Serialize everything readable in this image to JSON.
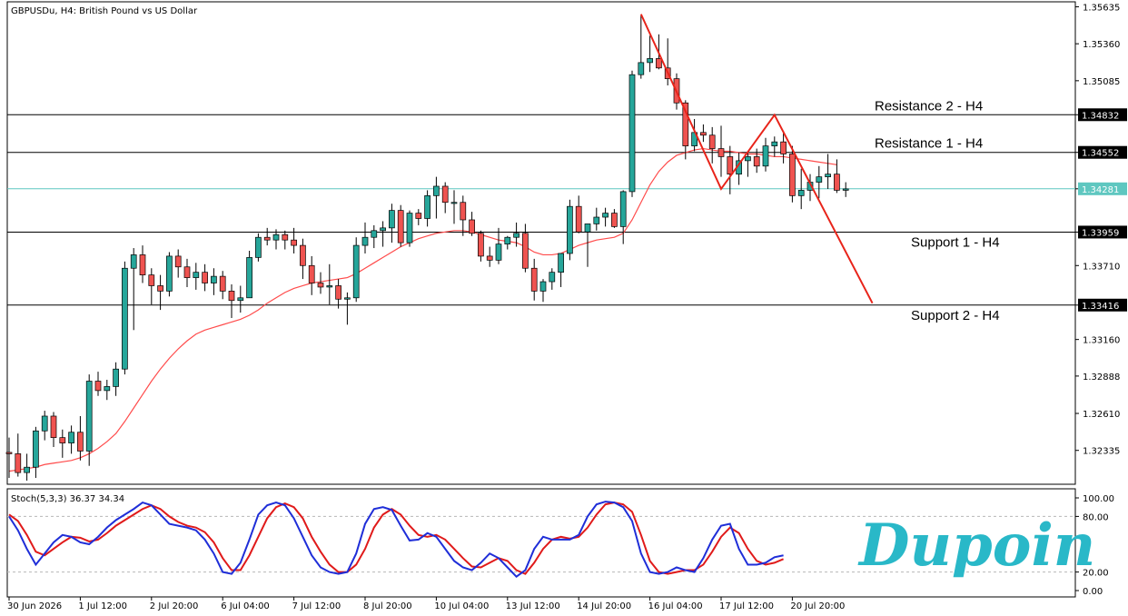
{
  "window": {
    "title": "GBPUSDu, H4:  British Pound vs US Dollar",
    "logo_text": "Dupoin"
  },
  "colors": {
    "bull": "#26a69a",
    "bear": "#ef5350",
    "candle_outline": "#000000",
    "ma": "#ff4b4b",
    "current_price": "#5fc7c0",
    "trendline": "#e8241a",
    "stoch_main": "#1f2ed8",
    "stoch_signal": "#e01a1a",
    "logo": "#29b8c8"
  },
  "chart_data": {
    "type": "candlestick",
    "symbol": "GBPUSDu",
    "timeframe": "H4",
    "ylim": [
      1.32083,
      1.35672
    ],
    "price_ticks": [
      "1.35635",
      "1.35360",
      "1.35085",
      "1.34832",
      "1.34552",
      "1.34281",
      "1.33959",
      "1.33710",
      "1.33416",
      "1.33160",
      "1.32888",
      "1.32610",
      "1.32335"
    ],
    "price_tick_values": [
      1.35635,
      1.3536,
      1.35085,
      1.34832,
      1.34552,
      1.34281,
      1.33959,
      1.3371,
      1.33416,
      1.3316,
      1.32888,
      1.3261,
      1.32335
    ],
    "time_labels": [
      "30 Jun 2026",
      "1 Jul 12:00",
      "2 Jul 20:00",
      "6 Jul 04:00",
      "7 Jul 12:00",
      "8 Jul 20:00",
      "10 Jul 04:00",
      "13 Jul 12:00",
      "14 Jul 20:00",
      "16 Jul 04:00",
      "17 Jul 12:00",
      "20 Jul 20:00"
    ],
    "time_label_bar_index": [
      0,
      8,
      16,
      24,
      32,
      40,
      48,
      56,
      64,
      72,
      80,
      88
    ],
    "current_price": "1.34281",
    "levels": [
      {
        "label": "Resistance 2 - H4",
        "price": "1.34832"
      },
      {
        "label": "Resistance 1 - H4",
        "price": "1.34552"
      },
      {
        "label": "Support 1 - H4",
        "price": "1.33959"
      },
      {
        "label": "Support 2 - H4",
        "price": "1.33416"
      }
    ],
    "ohlc": [
      [
        1.3232,
        1.3243,
        1.3213,
        1.3231
      ],
      [
        1.3231,
        1.3246,
        1.3214,
        1.3217
      ],
      [
        1.3217,
        1.3231,
        1.3211,
        1.3221
      ],
      [
        1.3221,
        1.3251,
        1.3213,
        1.3248
      ],
      [
        1.3248,
        1.3263,
        1.3241,
        1.3259
      ],
      [
        1.3259,
        1.3262,
        1.3236,
        1.3243
      ],
      [
        1.3243,
        1.3249,
        1.3228,
        1.3239
      ],
      [
        1.3239,
        1.3252,
        1.3231,
        1.3247
      ],
      [
        1.3247,
        1.3259,
        1.3226,
        1.3233
      ],
      [
        1.3233,
        1.329,
        1.3222,
        1.3285
      ],
      [
        1.3285,
        1.3292,
        1.3274,
        1.3278
      ],
      [
        1.3278,
        1.3286,
        1.3271,
        1.3281
      ],
      [
        1.3281,
        1.3299,
        1.3274,
        1.3294
      ],
      [
        1.3294,
        1.3374,
        1.329,
        1.3369
      ],
      [
        1.3369,
        1.3384,
        1.3323,
        1.3379
      ],
      [
        1.3379,
        1.3386,
        1.3358,
        1.3364
      ],
      [
        1.3364,
        1.3369,
        1.3342,
        1.3356
      ],
      [
        1.3356,
        1.3364,
        1.3338,
        1.3352
      ],
      [
        1.3352,
        1.3381,
        1.3348,
        1.3378
      ],
      [
        1.3378,
        1.3383,
        1.3362,
        1.337
      ],
      [
        1.337,
        1.3376,
        1.3355,
        1.3362
      ],
      [
        1.3362,
        1.3373,
        1.3353,
        1.3366
      ],
      [
        1.3366,
        1.3372,
        1.3352,
        1.3358
      ],
      [
        1.3358,
        1.3369,
        1.3349,
        1.3363
      ],
      [
        1.3363,
        1.3367,
        1.3346,
        1.3352
      ],
      [
        1.3352,
        1.3357,
        1.3332,
        1.3345
      ],
      [
        1.3345,
        1.3356,
        1.3336,
        1.3347
      ],
      [
        1.3347,
        1.3382,
        1.3347,
        1.3377
      ],
      [
        1.3377,
        1.3395,
        1.3374,
        1.3392
      ],
      [
        1.3392,
        1.3399,
        1.3386,
        1.339
      ],
      [
        1.339,
        1.3398,
        1.3383,
        1.3394
      ],
      [
        1.3394,
        1.3397,
        1.3383,
        1.339
      ],
      [
        1.339,
        1.3399,
        1.338,
        1.3386
      ],
      [
        1.3386,
        1.3391,
        1.3361,
        1.3371
      ],
      [
        1.3371,
        1.3378,
        1.3349,
        1.3358
      ],
      [
        1.3358,
        1.3366,
        1.335,
        1.3355
      ],
      [
        1.3355,
        1.3372,
        1.3342,
        1.3356
      ],
      [
        1.3356,
        1.3361,
        1.3339,
        1.3346
      ],
      [
        1.3346,
        1.3351,
        1.3327,
        1.3347
      ],
      [
        1.3347,
        1.3392,
        1.3344,
        1.3386
      ],
      [
        1.3386,
        1.3403,
        1.338,
        1.3392
      ],
      [
        1.3392,
        1.3401,
        1.3384,
        1.3397
      ],
      [
        1.3397,
        1.3404,
        1.3385,
        1.3399
      ],
      [
        1.3399,
        1.3417,
        1.3388,
        1.3412
      ],
      [
        1.3412,
        1.3416,
        1.3385,
        1.3388
      ],
      [
        1.3388,
        1.3412,
        1.3385,
        1.341
      ],
      [
        1.341,
        1.3413,
        1.3401,
        1.3406
      ],
      [
        1.3406,
        1.3427,
        1.34,
        1.3423
      ],
      [
        1.3423,
        1.3437,
        1.3406,
        1.343
      ],
      [
        1.343,
        1.3433,
        1.341,
        1.3418
      ],
      [
        1.3418,
        1.3427,
        1.3402,
        1.3418
      ],
      [
        1.3418,
        1.3423,
        1.3393,
        1.3405
      ],
      [
        1.3405,
        1.3411,
        1.3393,
        1.3395
      ],
      [
        1.3395,
        1.3397,
        1.3374,
        1.3378
      ],
      [
        1.3378,
        1.3385,
        1.337,
        1.3375
      ],
      [
        1.3375,
        1.3399,
        1.3372,
        1.3387
      ],
      [
        1.3387,
        1.3393,
        1.3383,
        1.3392
      ],
      [
        1.3392,
        1.3403,
        1.3385,
        1.3395
      ],
      [
        1.3395,
        1.3402,
        1.3366,
        1.3369
      ],
      [
        1.3369,
        1.3376,
        1.3345,
        1.3352
      ],
      [
        1.3352,
        1.3361,
        1.3344,
        1.3359
      ],
      [
        1.3359,
        1.3369,
        1.3353,
        1.3366
      ],
      [
        1.3366,
        1.3371,
        1.3355,
        1.338
      ],
      [
        1.338,
        1.342,
        1.3375,
        1.3415
      ],
      [
        1.3415,
        1.3423,
        1.3395,
        1.3396
      ],
      [
        1.3396,
        1.3402,
        1.337,
        1.3402
      ],
      [
        1.3402,
        1.3414,
        1.3397,
        1.3407
      ],
      [
        1.3407,
        1.3414,
        1.34,
        1.341
      ],
      [
        1.341,
        1.3413,
        1.3399,
        1.34
      ],
      [
        1.34,
        1.3427,
        1.3387,
        1.3426
      ],
      [
        1.3426,
        1.3516,
        1.3422,
        1.3513
      ],
      [
        1.3513,
        1.3557,
        1.351,
        1.3522
      ],
      [
        1.3522,
        1.3542,
        1.3515,
        1.3525
      ],
      [
        1.3525,
        1.3543,
        1.3517,
        1.3518
      ],
      [
        1.3518,
        1.354,
        1.3505,
        1.351
      ],
      [
        1.351,
        1.3514,
        1.3487,
        1.3492
      ],
      [
        1.3492,
        1.3494,
        1.345,
        1.346
      ],
      [
        1.346,
        1.348,
        1.3456,
        1.347
      ],
      [
        1.347,
        1.3476,
        1.3463,
        1.3468
      ],
      [
        1.3468,
        1.3474,
        1.3447,
        1.3458
      ],
      [
        1.3458,
        1.3475,
        1.3437,
        1.3452
      ],
      [
        1.3452,
        1.346,
        1.3424,
        1.3439
      ],
      [
        1.3439,
        1.3455,
        1.3431,
        1.3449
      ],
      [
        1.3449,
        1.3456,
        1.3437,
        1.3452
      ],
      [
        1.3452,
        1.3458,
        1.344,
        1.3445
      ],
      [
        1.3445,
        1.3466,
        1.3441,
        1.346
      ],
      [
        1.346,
        1.3467,
        1.3452,
        1.3463
      ],
      [
        1.3463,
        1.3471,
        1.3447,
        1.3454
      ],
      [
        1.3454,
        1.346,
        1.3418,
        1.3423
      ],
      [
        1.3423,
        1.3443,
        1.3413,
        1.3427
      ],
      [
        1.3427,
        1.3439,
        1.3419,
        1.3433
      ],
      [
        1.3433,
        1.3445,
        1.3421,
        1.3437
      ],
      [
        1.3437,
        1.3454,
        1.3428,
        1.3439
      ],
      [
        1.3439,
        1.345,
        1.3425,
        1.3427
      ],
      [
        1.3427,
        1.3433,
        1.3422,
        1.3428
      ]
    ],
    "ma": [
      1.3218,
      1.3219,
      1.322,
      1.3221,
      1.3223,
      1.3224,
      1.3225,
      1.3226,
      1.3228,
      1.3231,
      1.3235,
      1.324,
      1.3246,
      1.3255,
      1.3265,
      1.3275,
      1.3285,
      1.3294,
      1.3302,
      1.3309,
      1.3315,
      1.332,
      1.3323,
      1.3325,
      1.3327,
      1.3329,
      1.3331,
      1.3334,
      1.3338,
      1.3343,
      1.3347,
      1.3351,
      1.3354,
      1.3356,
      1.3358,
      1.3359,
      1.336,
      1.3361,
      1.3362,
      1.3365,
      1.3369,
      1.3373,
      1.3377,
      1.3381,
      1.3385,
      1.3388,
      1.3391,
      1.3393,
      1.3395,
      1.3396,
      1.3397,
      1.3397,
      1.3396,
      1.3394,
      1.3392,
      1.339,
      1.3389,
      1.3388,
      1.3385,
      1.3381,
      1.3379,
      1.3379,
      1.338,
      1.3383,
      1.3386,
      1.3388,
      1.339,
      1.3391,
      1.3392,
      1.3395,
      1.3405,
      1.3418,
      1.3431,
      1.3441,
      1.3448,
      1.3453,
      1.3455,
      1.3457,
      1.3458,
      1.3457,
      1.3456,
      1.3456,
      1.3455,
      1.3454,
      1.3454,
      1.3453,
      1.3452,
      1.3452,
      1.3451,
      1.345,
      1.3449,
      1.3448,
      1.3447,
      1.3446
    ],
    "trendline": [
      [
        71,
        1.3558
      ],
      [
        80,
        1.3428
      ],
      [
        86,
        1.3483
      ],
      [
        97,
        1.3343
      ]
    ],
    "stochastic": {
      "label": "Stoch(5,3,3) 36.37 34.34",
      "ylim": [
        0,
        100
      ],
      "ticks": [
        "100.00",
        "80.00",
        "20.00",
        "0.00"
      ],
      "tick_values": [
        100,
        80,
        20,
        0
      ],
      "levels": [
        80,
        20
      ],
      "main": [
        80,
        65,
        45,
        28,
        40,
        52,
        60,
        58,
        52,
        50,
        58,
        68,
        76,
        82,
        88,
        95,
        92,
        82,
        72,
        70,
        68,
        65,
        55,
        40,
        20,
        18,
        30,
        55,
        82,
        92,
        95,
        92,
        78,
        58,
        38,
        25,
        20,
        18,
        20,
        40,
        72,
        88,
        90,
        87,
        70,
        54,
        55,
        62,
        58,
        45,
        32,
        25,
        22,
        30,
        40,
        35,
        25,
        15,
        22,
        45,
        58,
        55,
        55,
        55,
        60,
        80,
        93,
        96,
        95,
        90,
        75,
        40,
        20,
        18,
        20,
        25,
        22,
        20,
        35,
        55,
        70,
        72,
        45,
        28,
        28,
        30,
        36,
        38
      ],
      "signal": [
        82,
        75,
        60,
        42,
        38,
        45,
        52,
        58,
        57,
        53,
        55,
        62,
        70,
        76,
        82,
        88,
        92,
        88,
        80,
        74,
        70,
        68,
        63,
        52,
        35,
        22,
        22,
        38,
        58,
        78,
        90,
        94,
        90,
        78,
        58,
        42,
        28,
        20,
        20,
        28,
        45,
        68,
        82,
        88,
        82,
        70,
        60,
        58,
        60,
        55,
        45,
        35,
        26,
        25,
        30,
        35,
        32,
        22,
        18,
        30,
        45,
        55,
        58,
        56,
        58,
        68,
        82,
        93,
        95,
        93,
        85,
        60,
        32,
        20,
        18,
        20,
        22,
        22,
        28,
        42,
        58,
        68,
        62,
        45,
        32,
        28,
        30,
        34
      ]
    }
  }
}
